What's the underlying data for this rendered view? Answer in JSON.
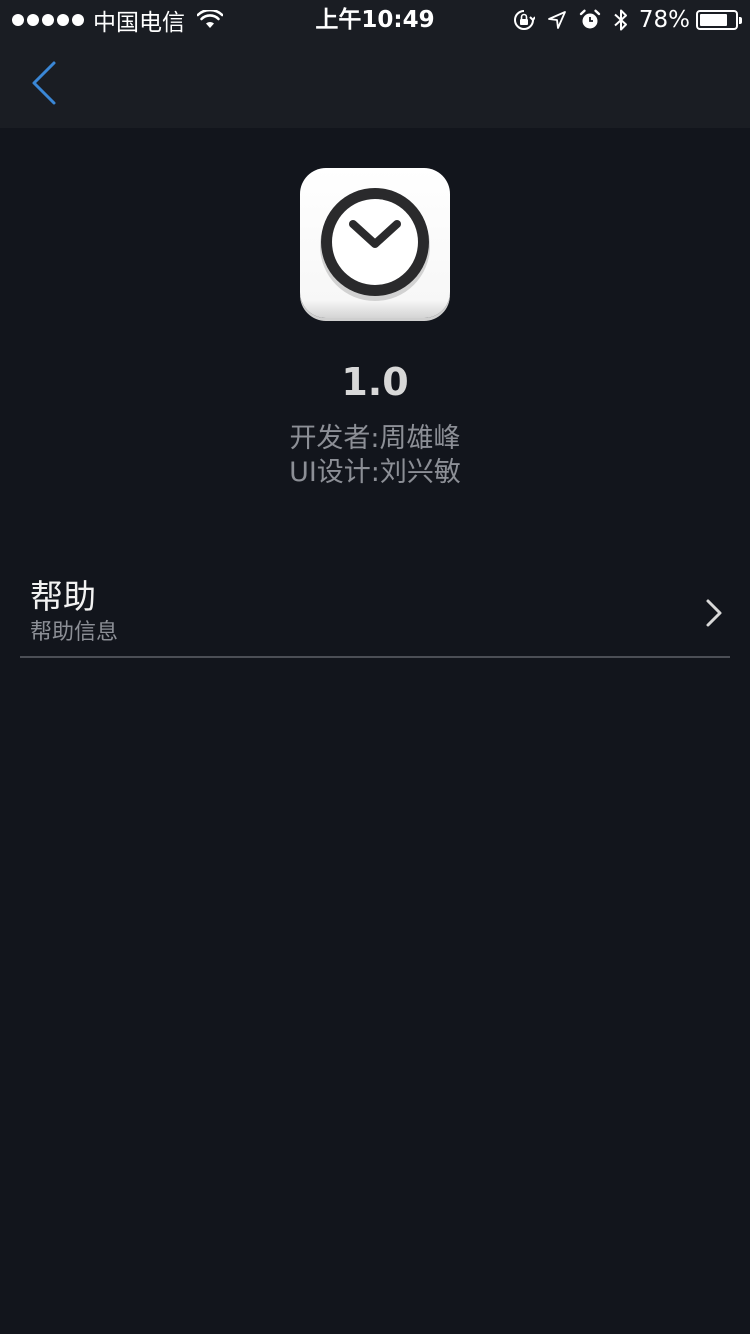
{
  "status_bar": {
    "carrier": "中国电信",
    "time": "上午10:49",
    "battery_percent": "78%",
    "battery_level": 0.78,
    "icons": [
      "signal-dots-icon",
      "wifi-icon",
      "orientation-lock-icon",
      "location-icon",
      "alarm-icon",
      "bluetooth-icon",
      "battery-icon"
    ]
  },
  "nav": {
    "back_icon": "chevron-left-icon",
    "accent_color": "#3a87d6"
  },
  "about": {
    "app_icon": "clock-icon",
    "version": "1.0",
    "developer": "开发者:周雄峰",
    "ui_designer": "UI设计:刘兴敏"
  },
  "menu": {
    "items": [
      {
        "title": "帮助",
        "subtitle": "帮助信息",
        "icon": "chevron-right-icon"
      }
    ]
  },
  "colors": {
    "background": "#12151c",
    "bar_background": "#1a1d23",
    "divider": "#4b4e55",
    "secondary_text": "#8c8f96"
  }
}
